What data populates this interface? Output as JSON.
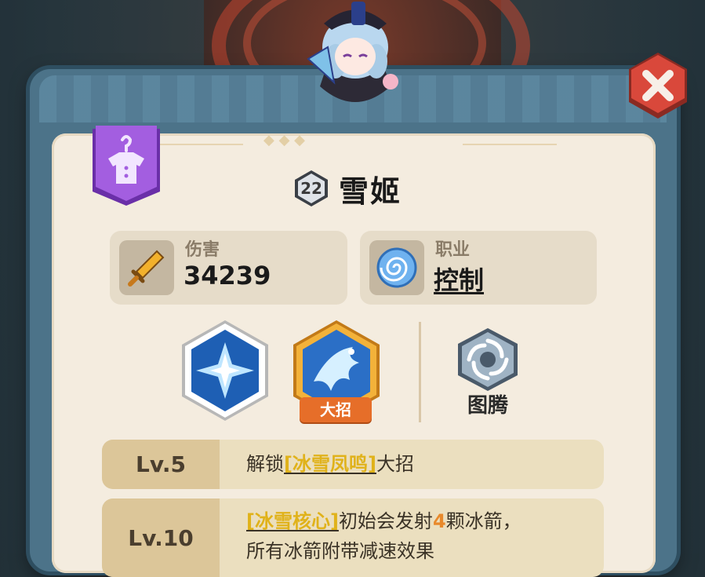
{
  "hero": {
    "level": "22",
    "name": "雪姬"
  },
  "stats": {
    "damage_label": "伤害",
    "damage_value": "34239",
    "class_label": "职业",
    "class_value": "控制"
  },
  "skills": {
    "ultimate_tag": "大招",
    "totem_label": "图腾"
  },
  "unlocks": [
    {
      "level": "Lv.5",
      "pre": "解锁",
      "skill": "[冰雪凤鸣]",
      "post": "大招"
    },
    {
      "level": "Lv.10",
      "skill": "[冰雪核心]",
      "mid": "初始会发射",
      "count": "4",
      "post": "颗冰箭，",
      "line2": "所有冰箭附带减速效果"
    }
  ],
  "colors": {
    "frame": "#4c7389",
    "paper": "#f4ecdf",
    "close_button": "#d9483b",
    "wardrobe_button": "#a35ee0",
    "ultimate_tag": "#e66e29",
    "highlight_text": "#e0b21a"
  },
  "icons": {
    "close": "close-icon",
    "wardrobe": "shirt-hanger-icon",
    "damage": "sword-icon",
    "class": "swirl-icon",
    "skill1": "ice-crystal-icon",
    "skill2": "ice-phoenix-icon",
    "totem": "vortex-icon"
  }
}
